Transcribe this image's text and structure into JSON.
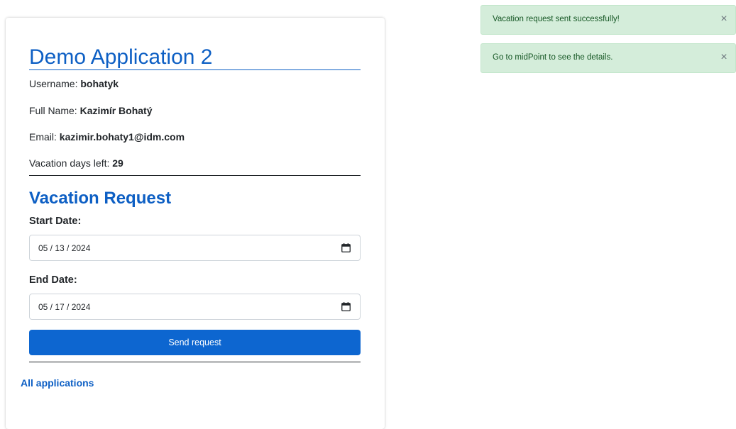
{
  "app": {
    "title": "Demo Application 2"
  },
  "user": {
    "username_label": "Username:",
    "username": "bohatyk",
    "fullname_label": "Full Name:",
    "fullname": "Kazimír Bohatý",
    "email_label": "Email:",
    "email": "kazimir.bohaty1@idm.com",
    "vacation_label": "Vacation days left:",
    "vacation_days": "29"
  },
  "request": {
    "title": "Vacation Request",
    "start_label": "Start Date:",
    "start_value": "05 / 13 / 2024",
    "end_label": "End Date:",
    "end_value": "05 / 17 / 2024",
    "send_label": "Send request"
  },
  "footer": {
    "all_apps_label": "All applications"
  },
  "notifications": [
    {
      "message": "Vacation request sent successfully!",
      "close": "×"
    },
    {
      "message": "Go to midPoint to see the details.",
      "close": "×"
    }
  ],
  "colors": {
    "accent": "#0d5fc4",
    "button": "#0d66d0",
    "toast_bg": "#d4edda"
  }
}
